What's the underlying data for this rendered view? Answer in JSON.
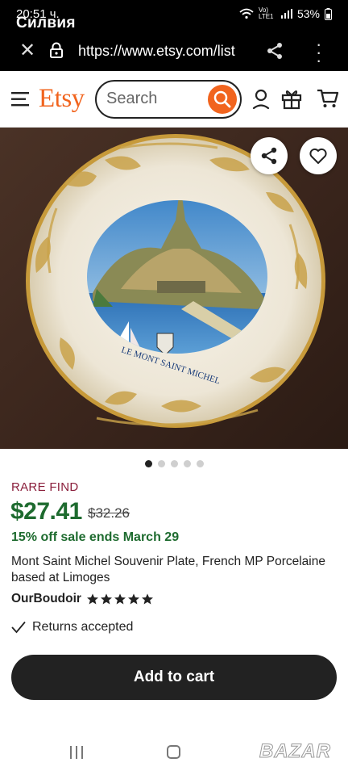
{
  "status": {
    "time": "20:51 ч.",
    "carrier": "Силвия",
    "signal_text": "Vo) LTE1",
    "battery": "53%"
  },
  "browser": {
    "url": "https://www.etsy.com/list"
  },
  "header": {
    "logo": "Etsy",
    "search_placeholder": "Search"
  },
  "hero": {
    "plate_caption": "LE MONT SAINT MICHEL",
    "slide_count": 5,
    "active_slide": 1
  },
  "product": {
    "badge": "RARE FIND",
    "price": "$27.41",
    "original_price": "$32.26",
    "sale_text": "15% off sale ends March 29",
    "title": "Mont Saint Michel Souvenir Plate, French MP Porcelaine based at Limoges",
    "shop_name": "OurBoudoir",
    "rating": 5,
    "returns": "Returns accepted",
    "add_to_cart": "Add to cart"
  },
  "watermark": "BAZAR",
  "colors": {
    "etsy_orange": "#f1641e",
    "sale_green": "#1e6b2f",
    "rare_red": "#8a1e3b",
    "button_dark": "#222222"
  },
  "icons": [
    "close-icon",
    "lock-icon",
    "share-icon",
    "more-icon",
    "menu-icon",
    "search-icon",
    "user-icon",
    "gift-icon",
    "cart-icon",
    "heart-icon",
    "star-icon",
    "check-icon"
  ]
}
